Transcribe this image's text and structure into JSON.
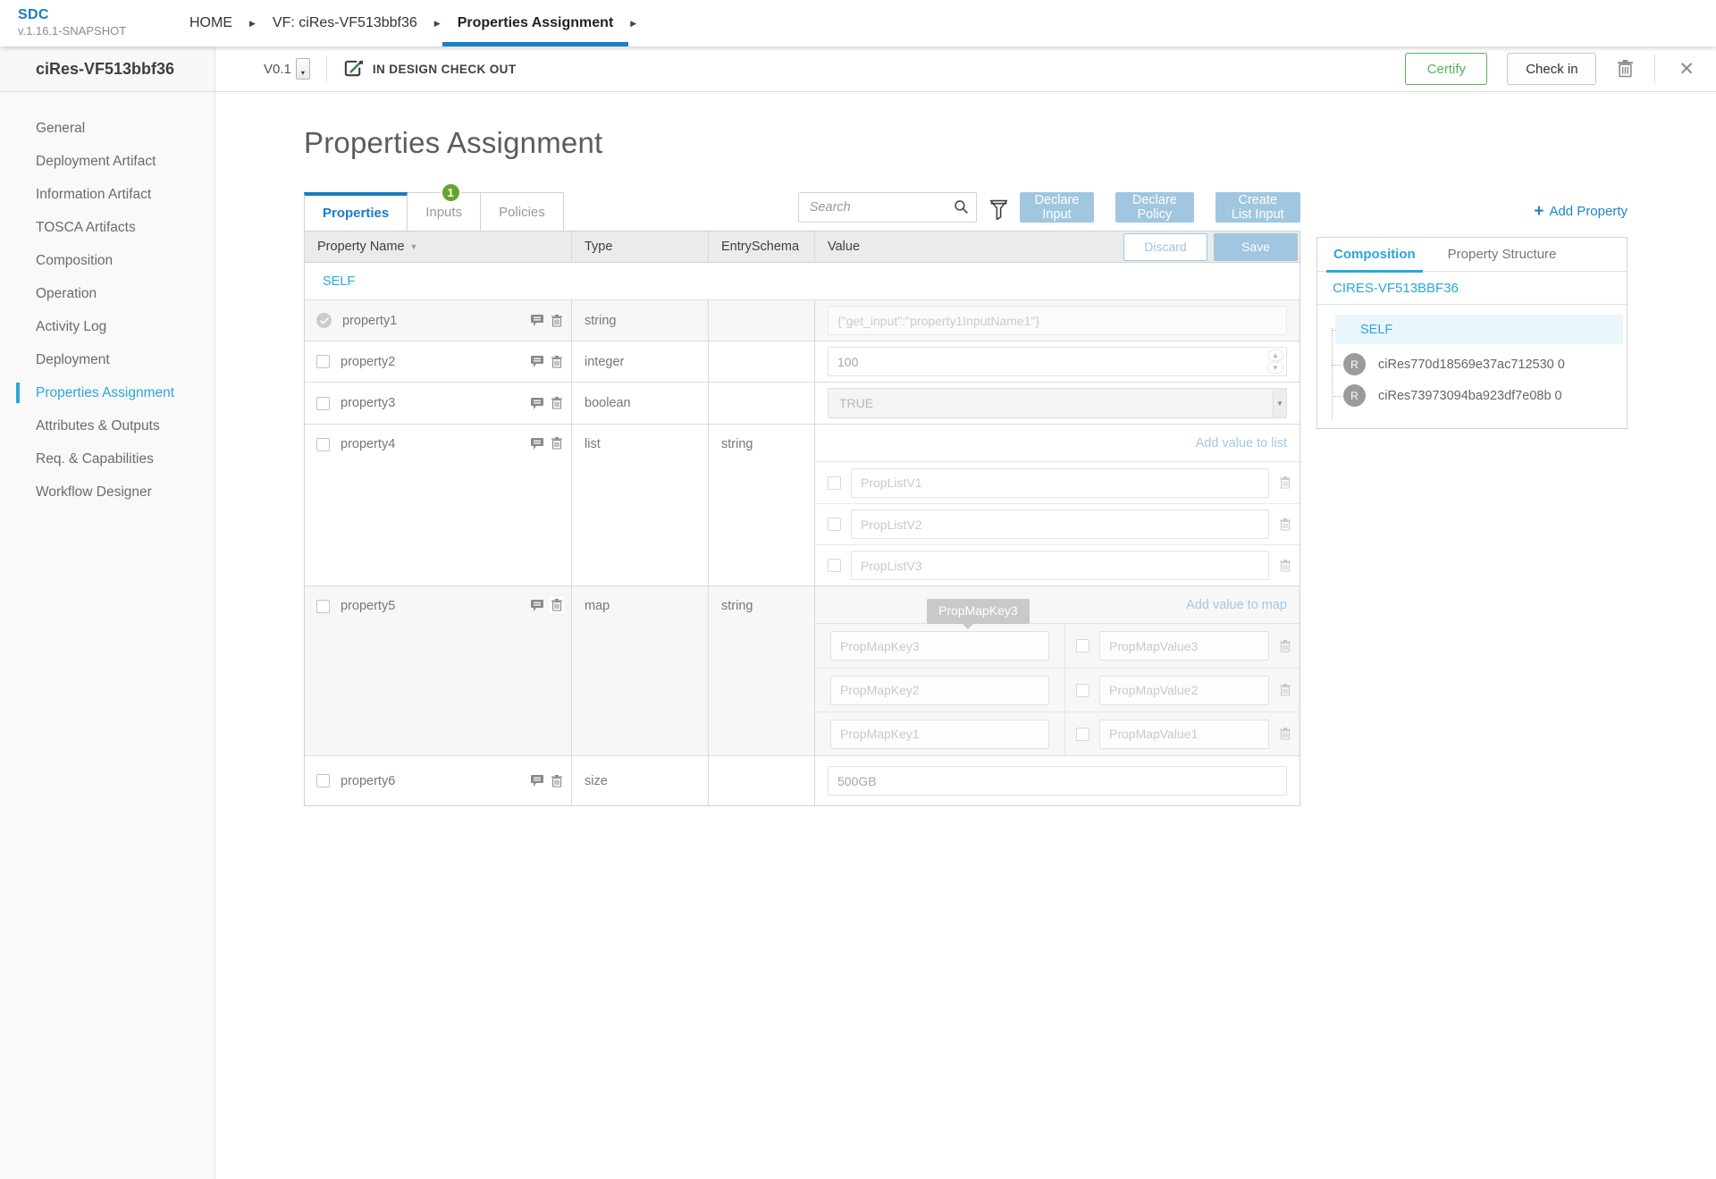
{
  "brand": {
    "name": "SDC",
    "version": "v.1.16.1-SNAPSHOT"
  },
  "breadcrumbs": {
    "items": [
      {
        "label": "HOME"
      },
      {
        "label": "VF: ciRes-VF513bbf36"
      },
      {
        "label": "Properties Assignment"
      }
    ]
  },
  "workspace": {
    "entity_name": "ciRes-VF513bbf36",
    "version": "V0.1",
    "status": "IN DESIGN CHECK OUT",
    "certify_label": "Certify",
    "check_in_label": "Check in"
  },
  "sidebar": {
    "items": [
      {
        "label": "General"
      },
      {
        "label": "Deployment Artifact"
      },
      {
        "label": "Information Artifact"
      },
      {
        "label": "TOSCA Artifacts"
      },
      {
        "label": "Composition"
      },
      {
        "label": "Operation"
      },
      {
        "label": "Activity Log"
      },
      {
        "label": "Deployment"
      },
      {
        "label": "Properties Assignment"
      },
      {
        "label": "Attributes & Outputs"
      },
      {
        "label": "Req. & Capabilities"
      },
      {
        "label": "Workflow Designer"
      }
    ]
  },
  "page": {
    "title": "Properties Assignment"
  },
  "tabs": [
    {
      "label": "Properties"
    },
    {
      "label": "Inputs",
      "badge": "1"
    },
    {
      "label": "Policies"
    }
  ],
  "toolbar": {
    "search_placeholder": "Search",
    "declare_input": "Declare Input",
    "declare_policy": "Declare Policy",
    "create_list_input": "Create List Input",
    "add_property_plus": "+",
    "add_property": "Add Property"
  },
  "table": {
    "columns": [
      "Property Name",
      "Type",
      "EntrySchema",
      "Value"
    ],
    "discard_label": "Discard",
    "save_label": "Save",
    "group_label": "SELF"
  },
  "properties": [
    {
      "name": "property1",
      "type": "string",
      "schema": "",
      "value": "{\"get_input\":\"property1InputName1\"}"
    },
    {
      "name": "property2",
      "type": "integer",
      "schema": "",
      "value": "100"
    },
    {
      "name": "property3",
      "type": "boolean",
      "schema": "",
      "value": "TRUE"
    },
    {
      "name": "property4",
      "type": "list",
      "schema": "string",
      "add_link": "Add value to list",
      "items": [
        "PropListV1",
        "PropListV2",
        "PropListV3"
      ]
    },
    {
      "name": "property5",
      "type": "map",
      "schema": "string",
      "add_link": "Add value to map",
      "tooltip": "PropMapKey3",
      "entries": [
        {
          "key": "PropMapKey3",
          "value": "PropMapValue3"
        },
        {
          "key": "PropMapKey2",
          "value": "PropMapValue2"
        },
        {
          "key": "PropMapKey1",
          "value": "PropMapValue1"
        }
      ]
    },
    {
      "name": "property6",
      "type": "size",
      "schema": "",
      "value": "500GB"
    }
  ],
  "composition_panel": {
    "tabs": [
      {
        "label": "Composition"
      },
      {
        "label": "Property Structure"
      }
    ],
    "root_label": "CIRES-VF513BBF36",
    "self_label": "SELF",
    "resources": [
      {
        "initial": "R",
        "label": "ciRes770d18569e37ac712530 0"
      },
      {
        "initial": "R",
        "label": "ciRes73973094ba923df7e08b 0"
      }
    ]
  },
  "colors": {
    "accent_blue": "#2aa7dc",
    "dark_blue": "#1a7cc0",
    "button_blue": "#a0c6e0",
    "certify_green": "#57b158",
    "badge_green": "#67a32e"
  }
}
